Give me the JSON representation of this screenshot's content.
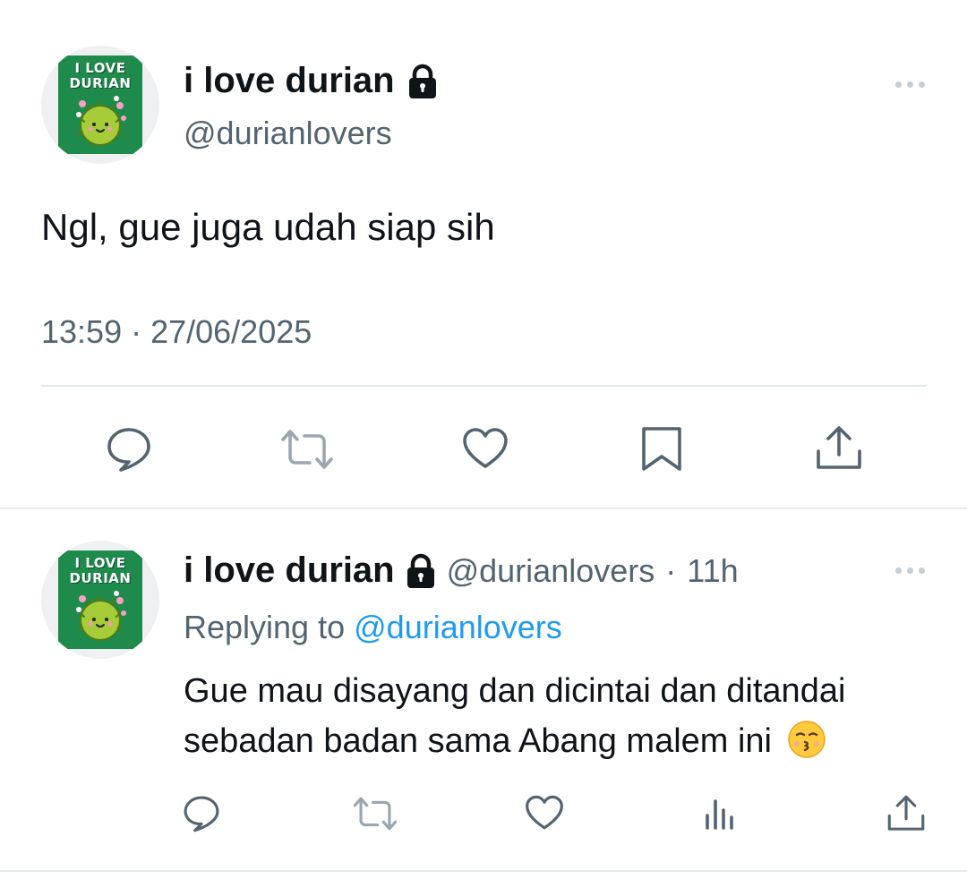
{
  "tweet": {
    "display_name": "i love durian",
    "handle": "@durianlovers",
    "text": "Ngl, gue juga udah siap sih",
    "time": "13:59",
    "separator": "·",
    "date": "27/06/2025",
    "avatar": {
      "logo_line1": "I LOVE",
      "logo_line2": "DURIAN"
    },
    "actions": [
      "reply-icon",
      "retweet-icon",
      "like-icon",
      "bookmark-icon",
      "share-icon"
    ]
  },
  "reply": {
    "display_name": "i love durian",
    "handle": "@durianlovers",
    "separator": "·",
    "age": "11h",
    "replying_prefix": "Replying to",
    "replying_to": "@durianlovers",
    "text_line1": "Gue mau disayang dan dicintai dan ditandai",
    "text_line2": "sebadan badan sama Abang malem ini",
    "emoji": "kissing-face-emoji",
    "avatar": {
      "logo_line1": "I LOVE",
      "logo_line2": "DURIAN"
    },
    "actions": [
      "reply-icon",
      "retweet-icon",
      "like-icon",
      "views-icon",
      "share-icon"
    ]
  },
  "colors": {
    "text": "#0f1419",
    "secondary": "#536471",
    "icon": "#536471",
    "link": "#1d9bf0",
    "divider": "#e3e8ec",
    "avatar_green": "#1e8a4c"
  }
}
